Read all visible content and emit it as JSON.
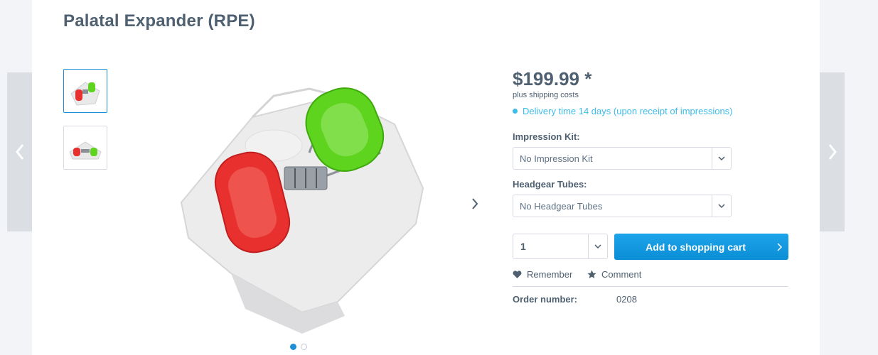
{
  "product": {
    "title": "Palatal Expander (RPE)",
    "price": "$199.99 *",
    "shipping_note": "plus shipping costs",
    "delivery": "Delivery time 14 days (upon receipt of impressions)"
  },
  "options": {
    "impression_kit": {
      "label": "Impression Kit:",
      "value": "No Impression Kit"
    },
    "headgear_tubes": {
      "label": "Headgear Tubes:",
      "value": "No Headgear Tubes"
    }
  },
  "purchase": {
    "quantity": "1",
    "cart_button": "Add to shopping cart"
  },
  "actions": {
    "remember": "Remember",
    "comment": "Comment"
  },
  "details": {
    "order_number_label": "Order number:",
    "order_number": "0208"
  },
  "gallery": {
    "image_count": 2,
    "active_index": 0
  },
  "colors": {
    "accent": "#1c8fd6",
    "delivery": "#3ebcea",
    "button": "#0a8ed5",
    "appliance_red": "#e8312f",
    "appliance_green": "#5fd41e"
  }
}
